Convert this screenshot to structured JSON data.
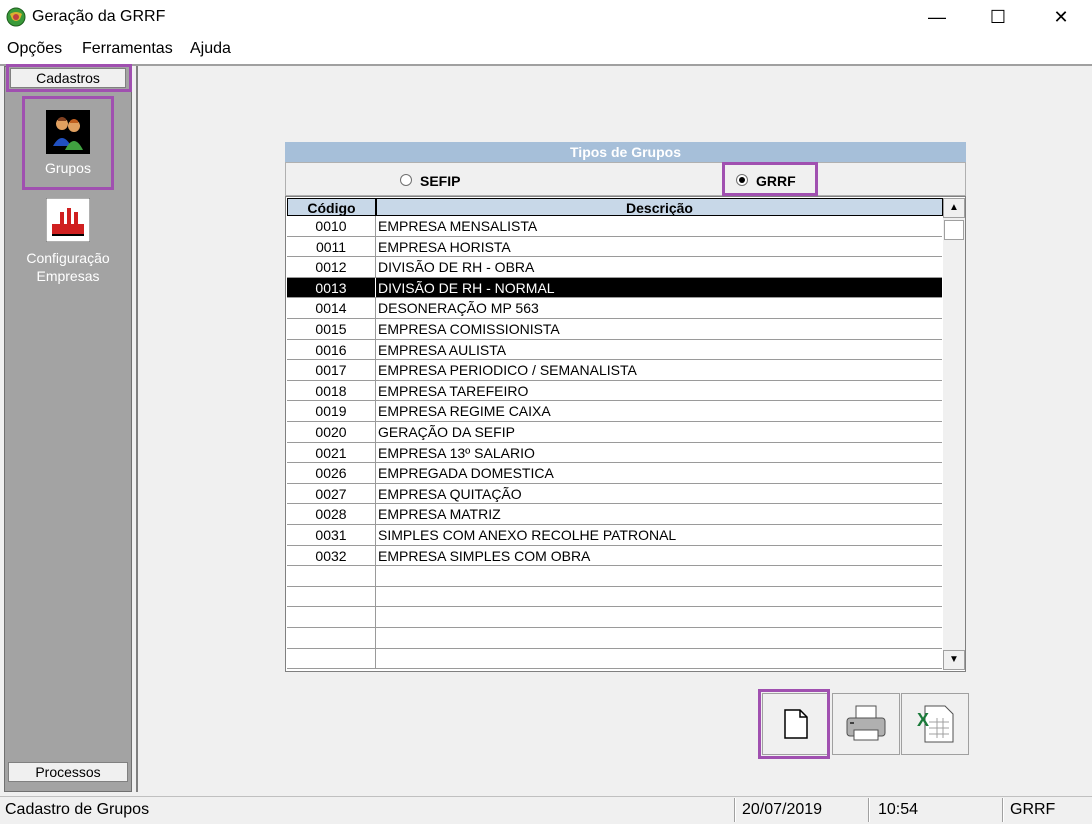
{
  "window": {
    "title": "Geração da GRRF",
    "minimize": "—",
    "maximize": "☐",
    "close": "✕"
  },
  "menu": [
    "Opções",
    "Ferramentas",
    "Ajuda"
  ],
  "sidebar": {
    "top_tab": "Cadastros",
    "items": [
      {
        "label": "Grupos",
        "icon": "users-group-icon"
      },
      {
        "label_line1": "Configuração",
        "label_line2": "Empresas",
        "icon": "factory-icon"
      }
    ],
    "bottom_tab": "Processos"
  },
  "panel": {
    "title": "Tipos de  Grupos",
    "radio_options": [
      {
        "label": "SEFIP",
        "selected": false
      },
      {
        "label": "GRRF",
        "selected": true
      }
    ]
  },
  "table": {
    "columns": [
      "Código",
      "Descrição"
    ],
    "rows": [
      {
        "code": "0010",
        "desc": "EMPRESA MENSALISTA"
      },
      {
        "code": "0011",
        "desc": "EMPRESA HORISTA"
      },
      {
        "code": "0012",
        "desc": "DIVISÃO DE RH - OBRA"
      },
      {
        "code": "0013",
        "desc": "DIVISÃO DE RH - NORMAL"
      },
      {
        "code": "0014",
        "desc": "DESONERAÇÃO MP 563"
      },
      {
        "code": "0015",
        "desc": "EMPRESA COMISSIONISTA"
      },
      {
        "code": "0016",
        "desc": "EMPRESA AULISTA"
      },
      {
        "code": "0017",
        "desc": "EMPRESA PERIODICO / SEMANALISTA"
      },
      {
        "code": "0018",
        "desc": "EMPRESA TAREFEIRO"
      },
      {
        "code": "0019",
        "desc": "EMPRESA REGIME CAIXA"
      },
      {
        "code": "0020",
        "desc": "GERAÇÃO DA SEFIP"
      },
      {
        "code": "0021",
        "desc": "EMPRESA 13º SALARIO"
      },
      {
        "code": "0026",
        "desc": "EMPREGADA DOMESTICA"
      },
      {
        "code": "0027",
        "desc": "EMPRESA QUITAÇÃO"
      },
      {
        "code": "0028",
        "desc": "EMPRESA MATRIZ"
      },
      {
        "code": "0031",
        "desc": "SIMPLES COM ANEXO RECOLHE PATRONAL"
      },
      {
        "code": "0032",
        "desc": "EMPRESA SIMPLES COM OBRA"
      }
    ],
    "selected_code": "0013",
    "empty_rows": 5
  },
  "toolbar": [
    {
      "icon": "new-document-icon"
    },
    {
      "icon": "printer-icon"
    },
    {
      "icon": "excel-export-icon"
    }
  ],
  "status": {
    "message": "Cadastro de Grupos",
    "date": "20/07/2019",
    "time": "10:54",
    "module": "GRRF"
  },
  "colors": {
    "highlight": "#a050b0",
    "panel_header": "#a6bfd9",
    "sidebar_bg": "#a3a3a3"
  }
}
